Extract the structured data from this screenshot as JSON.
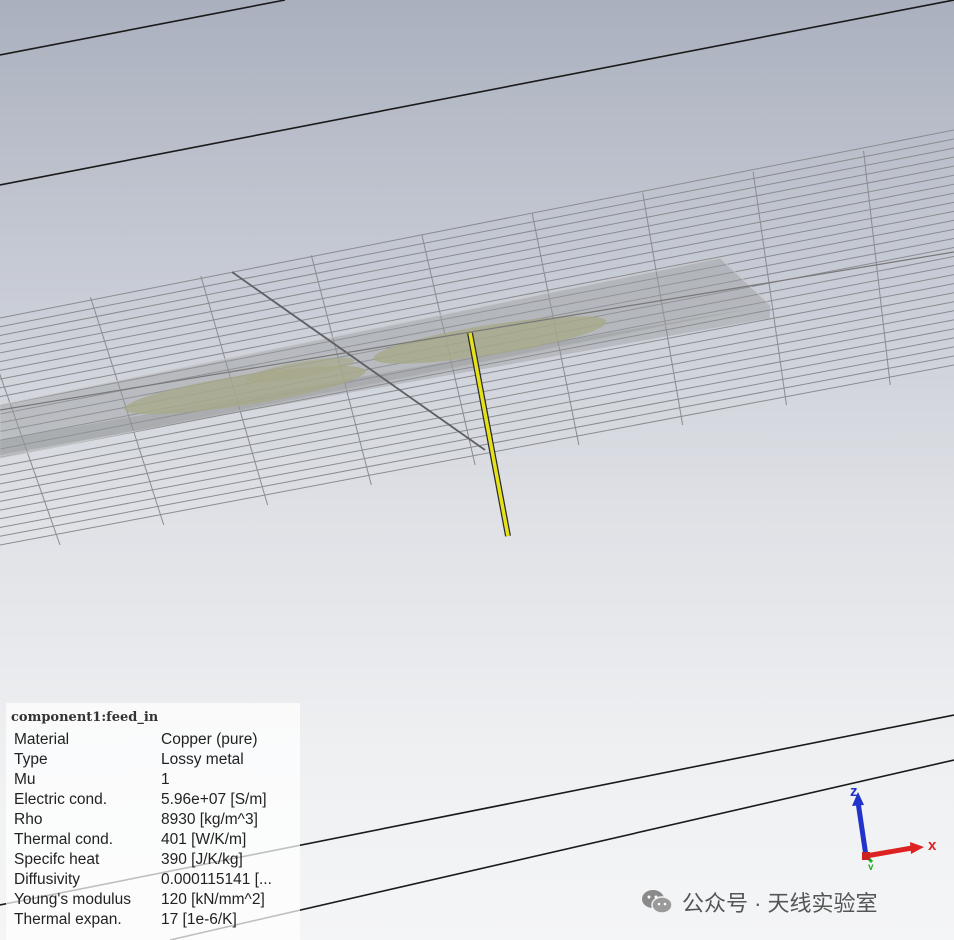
{
  "viewport": {
    "background_top": "#aab0be",
    "background_bottom": "#f4f5f6",
    "feed_color": "#e6e21a",
    "patch_color": "#a8a98a"
  },
  "info_panel": {
    "title": "component1:feed_in",
    "rows": [
      {
        "label": "Material",
        "value": "Copper (pure)"
      },
      {
        "label": "Type",
        "value": "Lossy metal"
      },
      {
        "label": "Mu",
        "value": "1"
      },
      {
        "label": "Electric cond.",
        "value": "5.96e+07 [S/m]"
      },
      {
        "label": "Rho",
        "value": "8930 [kg/m^3]"
      },
      {
        "label": "Thermal cond.",
        "value": "401 [W/K/m]"
      },
      {
        "label": "Specifc heat",
        "value": "390 [J/K/kg]"
      },
      {
        "label": "Diffusivity",
        "value": "0.000115141 [..."
      },
      {
        "label": "Young's modulus",
        "value": "120 [kN/mm^2]"
      },
      {
        "label": "Thermal expan.",
        "value": "17 [1e-6/K]"
      }
    ]
  },
  "axes": {
    "z_label": "z",
    "x_label": "x",
    "y_label": "y",
    "z_color": "#2233cc",
    "x_color": "#dd2222",
    "y_color": "#22aa22"
  },
  "watermark": {
    "icon": "wechat-icon",
    "text": "公众号 · 天线实验室"
  }
}
